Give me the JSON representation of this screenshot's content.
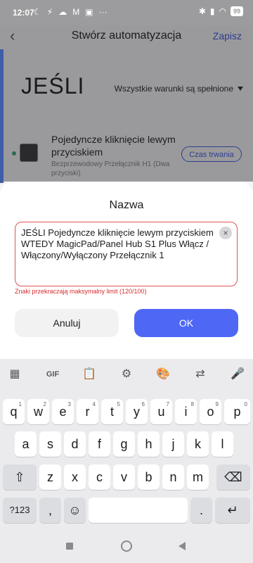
{
  "status": {
    "time": "12:07",
    "left_icons": [
      "☾",
      "⚡",
      "☁",
      "M",
      "▣",
      "···"
    ],
    "right_icons": [
      "✱",
      "▮",
      "◠"
    ],
    "battery": "99"
  },
  "header": {
    "back_symbol": "‹",
    "title": "Stwórz automatyzacja",
    "save": "Zapisz"
  },
  "condition_section": {
    "title": "JEŚLI",
    "condition_mode": "Wszystkie warunki są spełnione",
    "item": {
      "name": "Pojedyncze kliknięcie lewym przyciskiem",
      "subtitle": "Bezprzewodowy Przełącznik H1 (Dwa przyciski)",
      "duration_button": "Czas trwania"
    }
  },
  "dialog": {
    "title": "Nazwa",
    "input_value": "JEŚLI Pojedyncze kliknięcie lewym przyciskiem WTEDY MagicPad/Panel Hub S1 Plus Włącz / Włączony/Wyłączony Przełącznik 1",
    "clear": "×",
    "error": "Znaki przekraczają maksymalny limit (120/100)",
    "cancel": "Anuluj",
    "ok": "OK"
  },
  "keyboard": {
    "toolbar": [
      "▦",
      "GIF",
      "📋",
      "⚙",
      "🎨",
      "⇄",
      "🎤"
    ],
    "row1": [
      {
        "k": "q",
        "h": "1"
      },
      {
        "k": "w",
        "h": "2"
      },
      {
        "k": "e",
        "h": "3"
      },
      {
        "k": "r",
        "h": "4"
      },
      {
        "k": "t",
        "h": "5"
      },
      {
        "k": "y",
        "h": "6"
      },
      {
        "k": "u",
        "h": "7"
      },
      {
        "k": "i",
        "h": "8"
      },
      {
        "k": "o",
        "h": "9"
      },
      {
        "k": "p",
        "h": "0"
      }
    ],
    "row2": [
      "a",
      "s",
      "d",
      "f",
      "g",
      "h",
      "j",
      "k",
      "l"
    ],
    "row3": [
      "z",
      "x",
      "c",
      "v",
      "b",
      "n",
      "m"
    ],
    "shift": "⇧",
    "backspace": "⌫",
    "symbols": "?123",
    "comma": ",",
    "emoji": "☺",
    "period": ".",
    "enter": "↵"
  },
  "colors": {
    "accent": "#4f67f5",
    "error": "#d62c2c",
    "link": "#2c3c8c"
  }
}
